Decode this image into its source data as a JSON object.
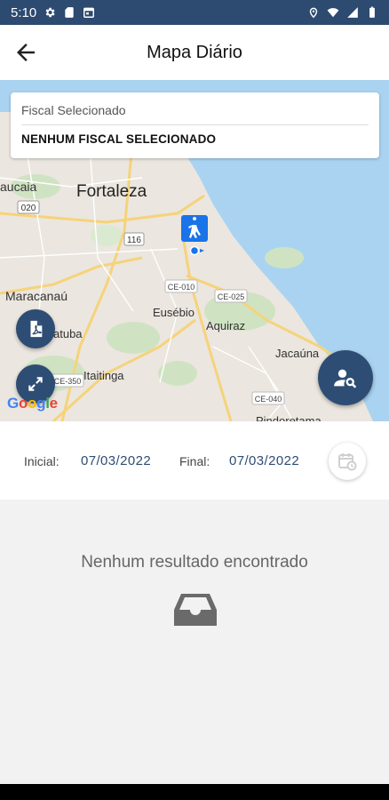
{
  "status_bar": {
    "time": "5:10",
    "icons_left": [
      "gear-icon",
      "sim-card-icon",
      "calendar-icon"
    ],
    "icons_right": [
      "location-icon",
      "wifi-icon",
      "signal-icon",
      "battery-icon"
    ]
  },
  "app_bar": {
    "title": "Mapa Diário",
    "back_icon": "arrow-back-icon"
  },
  "map": {
    "fiscal_card": {
      "label": "Fiscal Selecionado",
      "value": "NENHUM FISCAL SELECIONADO"
    },
    "place_labels": {
      "fortaleza": "Fortaleza",
      "caucaia": "aucaia",
      "maracanau": "Maracanaú",
      "eusebio": "Eusébio",
      "aquiraz": "Aquiraz",
      "itaitinga": "Itaitinga",
      "jacauna": "Jacaúna",
      "pacatuba": "atuba",
      "precabura": "Pindoretama"
    },
    "road_labels": {
      "r020": "020",
      "r116": "116",
      "ce010": "CE-010",
      "ce025": "CE-025",
      "ce350": "CE-350",
      "ce040": "CE-040"
    },
    "google_logo": {
      "letters": [
        "G",
        "o",
        "o",
        "g",
        "l",
        "e"
      ],
      "colors": [
        "#4285F4",
        "#EA4335",
        "#FBBC05",
        "#4285F4",
        "#34A853",
        "#EA4335"
      ]
    },
    "buttons": {
      "pdf_icon": "pdf-file-icon",
      "expand_icon": "fullscreen-icon",
      "search_user_icon": "search-user-icon"
    }
  },
  "dates": {
    "initial_label": "Inicial:",
    "initial_value": "07/03/2022",
    "final_label": "Final:",
    "final_value": "07/03/2022",
    "calendar_icon": "calendar-clock-icon"
  },
  "empty_state": {
    "message": "Nenhum resultado encontrado",
    "icon": "inbox-icon"
  },
  "colors": {
    "primary": "#2e4d74",
    "status_bar": "#2d4a70",
    "water": "#a9d3f1",
    "marker": "#1a73e8"
  }
}
